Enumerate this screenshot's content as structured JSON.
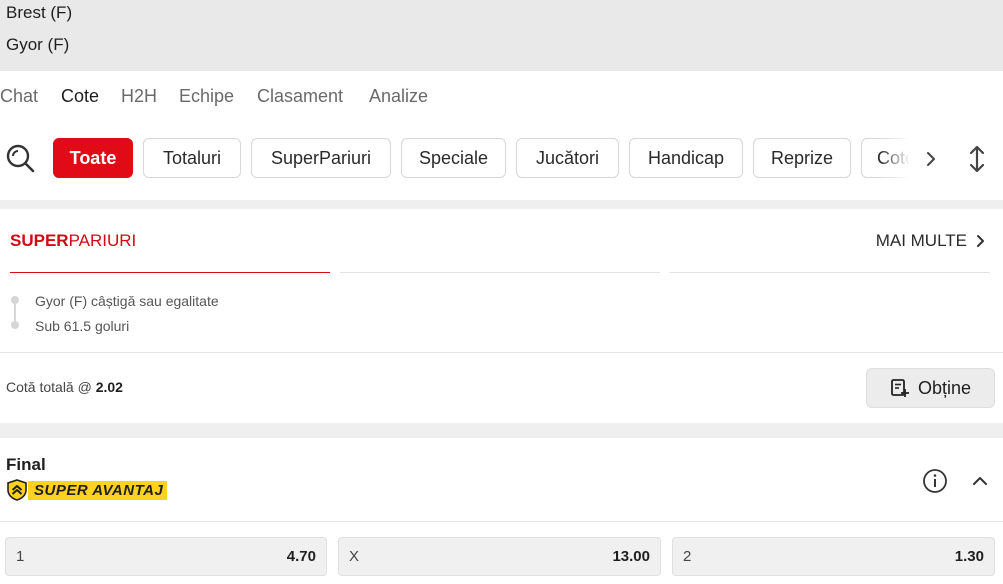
{
  "match": {
    "home": "Brest (F)",
    "away": "Gyor (F)"
  },
  "tabs": [
    {
      "label": "Chat",
      "active": false
    },
    {
      "label": "Cote",
      "active": true
    },
    {
      "label": "H2H",
      "active": false
    },
    {
      "label": "Echipe",
      "active": false
    },
    {
      "label": "Clasament",
      "active": false
    },
    {
      "label": "Analize",
      "active": false
    }
  ],
  "filters": [
    {
      "label": "Toate",
      "active": true
    },
    {
      "label": "Totaluri",
      "active": false
    },
    {
      "label": "SuperPariuri",
      "active": false
    },
    {
      "label": "Speciale",
      "active": false
    },
    {
      "label": "Jucători",
      "active": false
    },
    {
      "label": "Handicap",
      "active": false
    },
    {
      "label": "Reprize",
      "active": false
    },
    {
      "label": "Cote",
      "active": false
    }
  ],
  "superpariuri": {
    "logo_bold": "SUPER",
    "logo_rest": "PARIURI",
    "more_label": "MAI MULTE",
    "selections": [
      "Gyor (F) câștigă sau egalitate",
      "Sub 61.5 goluri"
    ],
    "total_label": "Cotă totală @",
    "total_value": "2.02",
    "get_label": "Obține"
  },
  "final_market": {
    "title": "Final",
    "badge": "SUPER AVANTAJ",
    "odds": [
      {
        "label": "1",
        "value": "4.70"
      },
      {
        "label": "X",
        "value": "13.00"
      },
      {
        "label": "2",
        "value": "1.30"
      }
    ]
  },
  "colors": {
    "accent": "#e10b17",
    "badge": "#ffd21f"
  },
  "icons": [
    "search-icon",
    "chevron-right-icon",
    "expand-vertical-icon",
    "betslip-add-icon",
    "shield-chevron-icon",
    "info-icon",
    "chevron-up-icon"
  ]
}
